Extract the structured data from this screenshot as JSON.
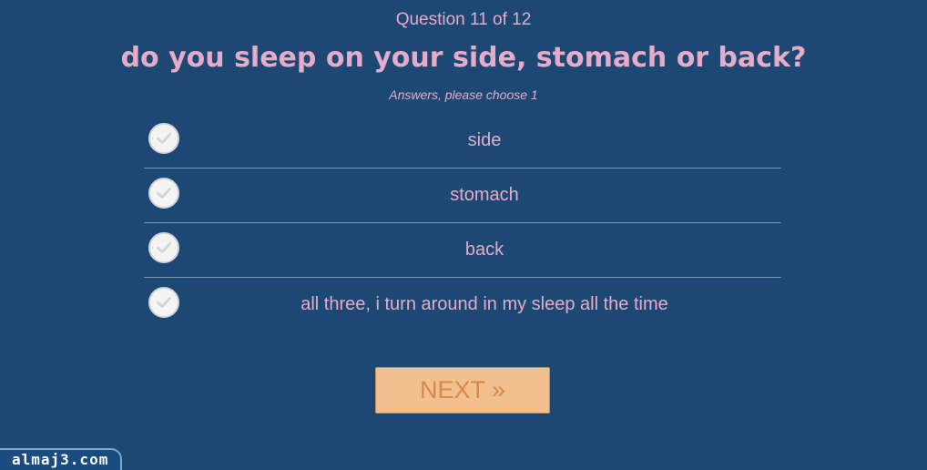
{
  "quiz": {
    "progress": "Question 11 of 12",
    "question": "do you sleep on your side, stomach or back?",
    "instructions": "Answers, please choose 1",
    "answers": [
      {
        "label": "side",
        "icon": "check-icon"
      },
      {
        "label": "stomach",
        "icon": "check-icon"
      },
      {
        "label": "back",
        "icon": "check-icon"
      },
      {
        "label": "all three, i turn around in my sleep all the time",
        "icon": "check-icon"
      }
    ],
    "next_label": "NEXT »"
  },
  "watermark": {
    "text": "almaj3.com"
  },
  "colors": {
    "background": "#1e4874",
    "text": "#e4acc8",
    "button_fill": "#f2c08f",
    "button_text": "#d8884a",
    "divider": "#7b95b0",
    "check_fill": "#f4f4f4",
    "check_mark": "#d0d4d8"
  }
}
